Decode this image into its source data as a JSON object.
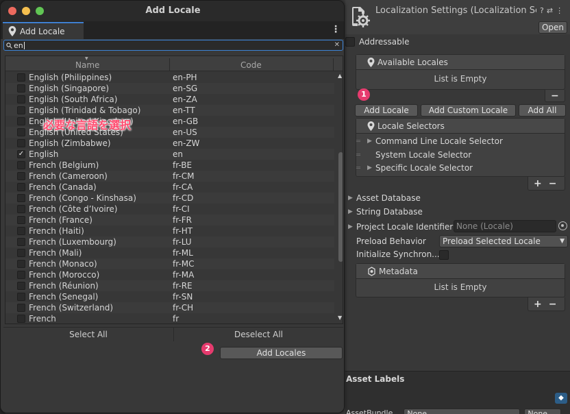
{
  "inspector": {
    "title": "Localization Settings (Localization Set",
    "header_icons": [
      "?",
      "⇄",
      "⋮"
    ],
    "open_label": "Open",
    "addressable_label": "Addressable",
    "available_locales": {
      "title": "Available Locales",
      "empty_text": "List is Empty",
      "minus": "−"
    },
    "buttons": {
      "add_locale": "Add Locale",
      "add_custom_locale": "Add Custom Locale",
      "add_all": "Add All"
    },
    "locale_selectors": {
      "title": "Locale Selectors",
      "items": [
        "Command Line Locale Selector",
        "System Locale Selector",
        "Specific Locale Selector"
      ],
      "plus": "+",
      "minus": "−"
    },
    "foldouts": {
      "asset_database": "Asset Database",
      "string_database": "String Database",
      "project_locale_identifier": "Project Locale Identifier"
    },
    "project_locale_value": "None (Locale)",
    "preload_behavior_label": "Preload Behavior",
    "preload_behavior_value": "Preload Selected Locale",
    "initialize_sync_label": "Initialize Synchron...",
    "metadata": {
      "title": "Metadata",
      "empty_text": "List is Empty",
      "plus": "+",
      "minus": "−"
    },
    "asset_labels_title": "Asset Labels",
    "asset_bundle_label": "AssetBundle",
    "asset_bundle_value": "None",
    "asset_bundle_variant": "None"
  },
  "window": {
    "title": "Add Locale",
    "tab_label": "Add Locale",
    "search_value": "en",
    "columns": {
      "name": "Name",
      "code": "Code"
    },
    "rows": [
      {
        "name": "English (Philippines)",
        "code": "en-PH",
        "checked": false
      },
      {
        "name": "English (Singapore)",
        "code": "en-SG",
        "checked": false
      },
      {
        "name": "English (South Africa)",
        "code": "en-ZA",
        "checked": false
      },
      {
        "name": "English (Trinidad & Tobago)",
        "code": "en-TT",
        "checked": false
      },
      {
        "name": "English (United Kingdom)",
        "code": "en-GB",
        "checked": false
      },
      {
        "name": "English (United States)",
        "code": "en-US",
        "checked": false
      },
      {
        "name": "English (Zimbabwe)",
        "code": "en-ZW",
        "checked": false
      },
      {
        "name": "English",
        "code": "en",
        "checked": true
      },
      {
        "name": "French (Belgium)",
        "code": "fr-BE",
        "checked": false
      },
      {
        "name": "French (Cameroon)",
        "code": "fr-CM",
        "checked": false
      },
      {
        "name": "French (Canada)",
        "code": "fr-CA",
        "checked": false
      },
      {
        "name": "French (Congo - Kinshasa)",
        "code": "fr-CD",
        "checked": false
      },
      {
        "name": "French (Côte d’Ivoire)",
        "code": "fr-CI",
        "checked": false
      },
      {
        "name": "French (France)",
        "code": "fr-FR",
        "checked": false
      },
      {
        "name": "French (Haiti)",
        "code": "fr-HT",
        "checked": false
      },
      {
        "name": "French (Luxembourg)",
        "code": "fr-LU",
        "checked": false
      },
      {
        "name": "French (Mali)",
        "code": "fr-ML",
        "checked": false
      },
      {
        "name": "French (Monaco)",
        "code": "fr-MC",
        "checked": false
      },
      {
        "name": "French (Morocco)",
        "code": "fr-MA",
        "checked": false
      },
      {
        "name": "French (Réunion)",
        "code": "fr-RE",
        "checked": false
      },
      {
        "name": "French (Senegal)",
        "code": "fr-SN",
        "checked": false
      },
      {
        "name": "French (Switzerland)",
        "code": "fr-CH",
        "checked": false
      },
      {
        "name": "French",
        "code": "fr",
        "checked": false
      }
    ],
    "select_all_label": "Select All",
    "deselect_all_label": "Deselect All",
    "add_locales_label": "Add Locales"
  },
  "annotations": {
    "overlay_text": "必要な言語を選択",
    "marker_1": "1",
    "marker_2": "2"
  },
  "colors": {
    "accent": "#3c83d6",
    "marker": "#e63b6e",
    "overlay_text": "#ff4a6e"
  }
}
